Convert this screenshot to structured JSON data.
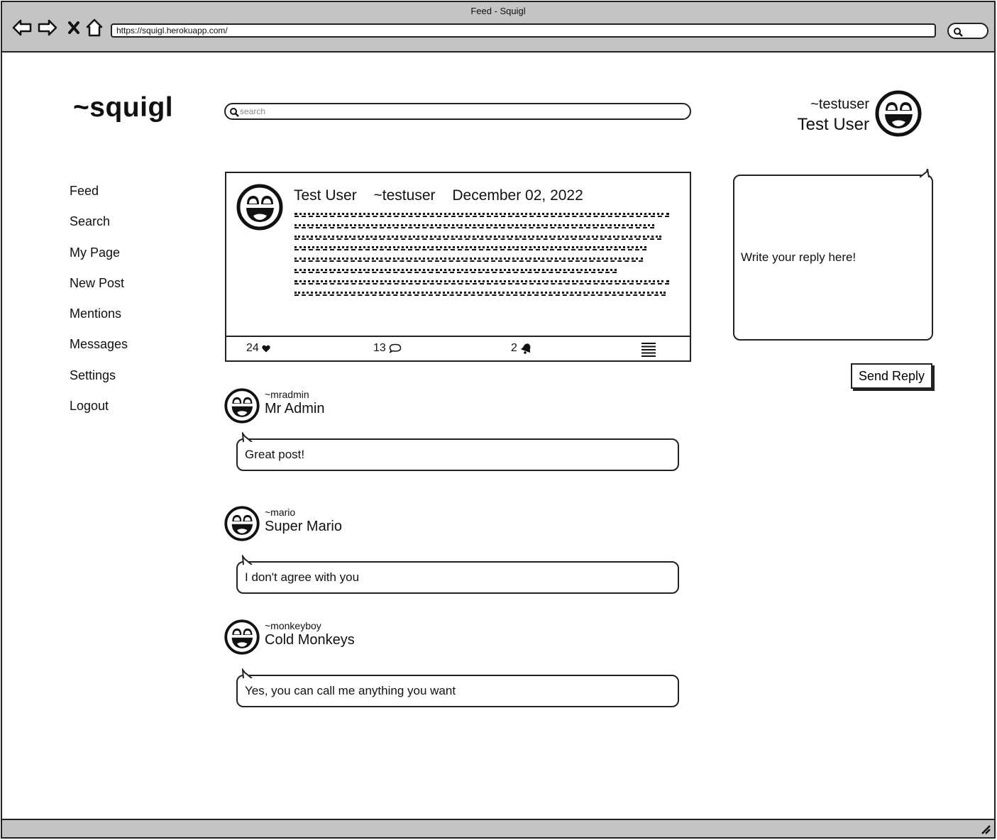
{
  "browser": {
    "window_title": "Feed - Squigl",
    "url": "https://squigl.herokuapp.com/",
    "icons": [
      "back-icon",
      "forward-icon",
      "stop-icon",
      "home-icon",
      "search-icon",
      "resize-grip-icon"
    ]
  },
  "header": {
    "logo": "~squigl",
    "search_placeholder": "search",
    "current_user": {
      "handle": "~testuser",
      "name": "Test User",
      "avatar": "laughing-face-icon"
    }
  },
  "sidebar": {
    "items": [
      {
        "label": "Feed"
      },
      {
        "label": "Search"
      },
      {
        "label": "My Page"
      },
      {
        "label": "New Post"
      },
      {
        "label": "Mentions"
      },
      {
        "label": "Messages"
      },
      {
        "label": "Settings"
      },
      {
        "label": "Logout"
      }
    ]
  },
  "post": {
    "author_name": "Test User",
    "author_handle": "~testuser",
    "date": "December 02, 2022",
    "likes": "24",
    "comments": "13",
    "notifications": "2",
    "icons": [
      "heart-icon",
      "comment-icon",
      "bell-icon",
      "menu-icon"
    ]
  },
  "reply_form": {
    "placeholder": "Write your reply here!",
    "button_label": "Send Reply"
  },
  "replies": [
    {
      "handle": "~mradmin",
      "name": "Mr Admin",
      "text": "Great post!"
    },
    {
      "handle": "~mario",
      "name": "Super Mario",
      "text": "I don't agree with you"
    },
    {
      "handle": "~monkeyboy",
      "name": "Cold Monkeys",
      "text": "Yes, you can call me anything you want"
    }
  ]
}
